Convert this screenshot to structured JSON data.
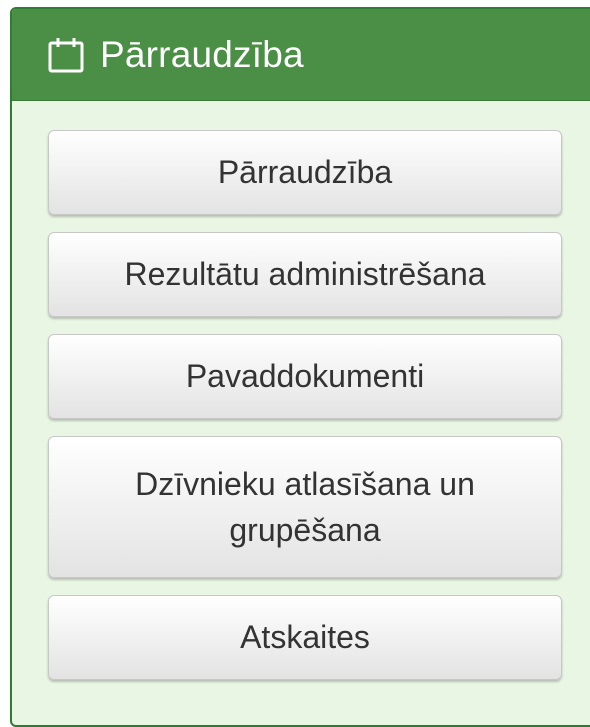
{
  "panel": {
    "title": "Pārraudzība",
    "icon": "calendar-icon",
    "header_color": "#4a8f45",
    "body_color": "#eaf6e4"
  },
  "menu": {
    "items": [
      {
        "label": "Pārraudzība"
      },
      {
        "label": "Rezultātu administrēšana"
      },
      {
        "label": "Pavaddokumenti"
      },
      {
        "label": "Dzīvnieku atlasīšana un grupēšana"
      },
      {
        "label": "Atskaites"
      }
    ]
  }
}
